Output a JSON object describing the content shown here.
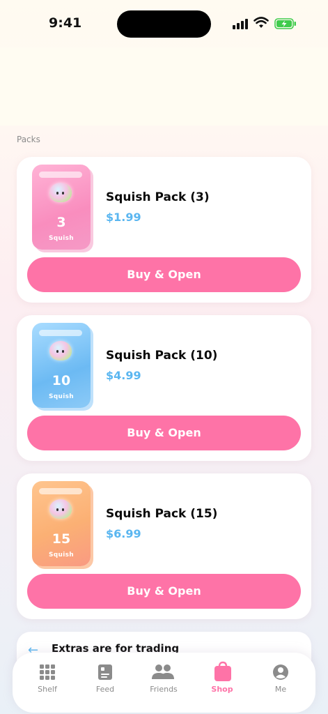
{
  "status_bar": {
    "time": "9:41"
  },
  "section": {
    "label": "Packs"
  },
  "packs": [
    {
      "name": "Squish Pack (3)",
      "price": "$1.99",
      "count": "3",
      "sub": "Squish",
      "button": "Buy & Open",
      "color": "#f98dbe"
    },
    {
      "name": "Squish Pack (10)",
      "price": "$4.99",
      "count": "10",
      "sub": "Squish",
      "button": "Buy & Open",
      "color": "#6cbaf3"
    },
    {
      "name": "Squish Pack (15)",
      "price": "$6.99",
      "count": "15",
      "sub": "Squish",
      "button": "Buy & Open",
      "color": "#fbb074"
    }
  ],
  "extras": {
    "text": "Extras are for trading",
    "icon": "arrow-left-icon"
  },
  "tabs": [
    {
      "label": "Shelf",
      "icon": "grid-icon",
      "active": false
    },
    {
      "label": "Feed",
      "icon": "feed-card-icon",
      "active": false
    },
    {
      "label": "Friends",
      "icon": "people-icon",
      "active": false
    },
    {
      "label": "Shop",
      "icon": "shopping-bag-icon",
      "active": true
    },
    {
      "label": "Me",
      "icon": "person-icon",
      "active": false
    }
  ],
  "colors": {
    "accent": "#fe73a7",
    "price": "#5ab6f0",
    "tab_inactive": "#8b8b8b"
  }
}
